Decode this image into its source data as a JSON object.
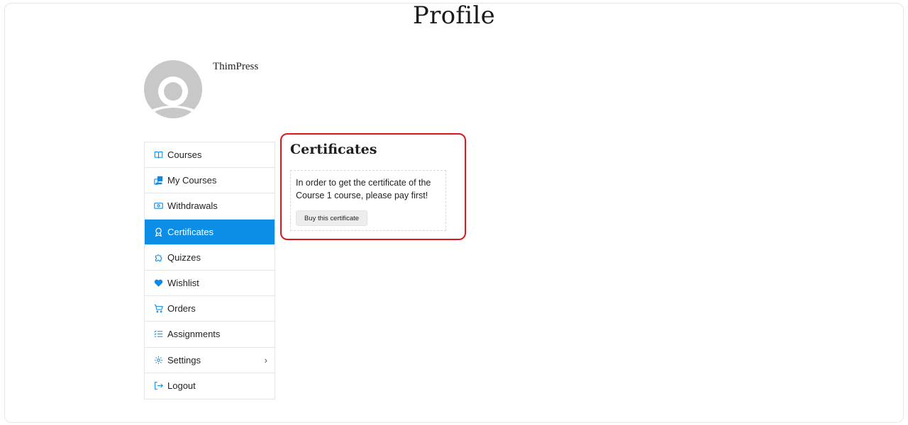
{
  "page": {
    "title": "Profile"
  },
  "user": {
    "name": "ThimPress"
  },
  "menu": {
    "items": [
      {
        "label": "Courses",
        "icon": "book-open-icon"
      },
      {
        "label": "My Courses",
        "icon": "course-stack-icon"
      },
      {
        "label": "Withdrawals",
        "icon": "cash-icon"
      },
      {
        "label": "Certificates",
        "icon": "award-icon",
        "active": true
      },
      {
        "label": "Quizzes",
        "icon": "puzzle-icon"
      },
      {
        "label": "Wishlist",
        "icon": "heart-icon"
      },
      {
        "label": "Orders",
        "icon": "cart-icon"
      },
      {
        "label": "Assignments",
        "icon": "list-icon"
      },
      {
        "label": "Settings",
        "icon": "gear-icon",
        "has_submenu": true
      },
      {
        "label": "Logout",
        "icon": "logout-icon"
      }
    ]
  },
  "certificates": {
    "title": "Certificates",
    "message": "In order to get the certificate of the Course 1 course, please pay first!",
    "buy_label": "Buy this certificate"
  },
  "colors": {
    "accent": "#0d8ee6",
    "highlight": "#e0161c",
    "avatar": "#c8c8c8"
  }
}
